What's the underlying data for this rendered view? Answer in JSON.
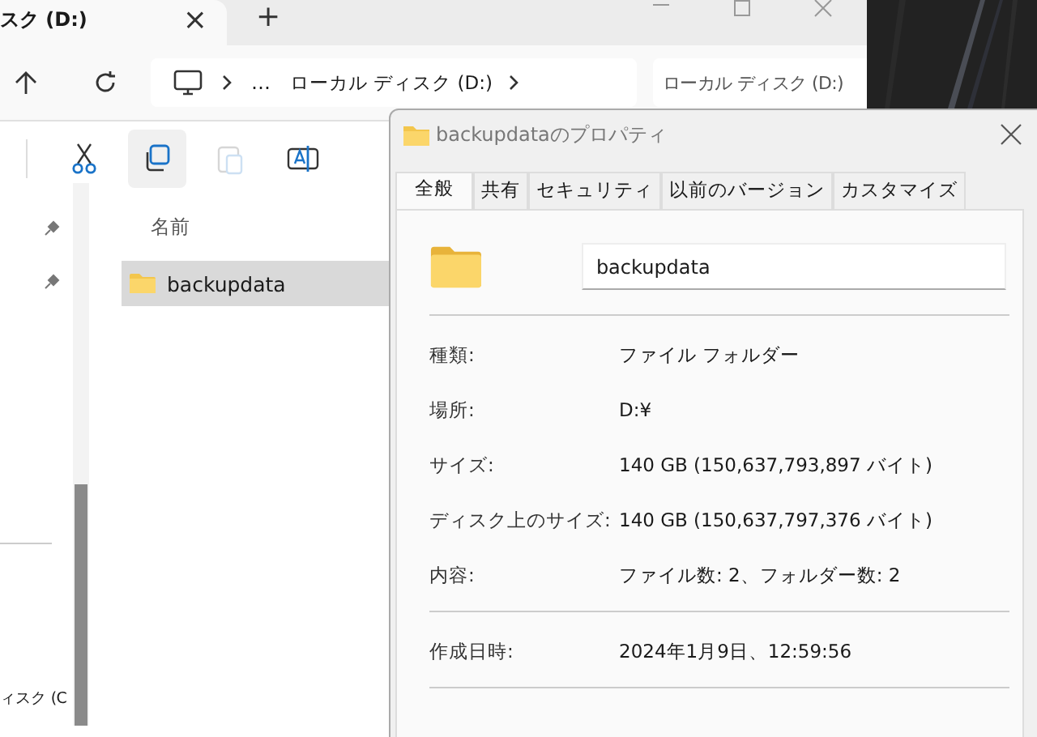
{
  "explorer": {
    "tab": {
      "title": "スク (D:)",
      "close": "×"
    },
    "new_tab": "+",
    "breadcrumb": {
      "more": "…",
      "location": "ローカル ディスク (D:)"
    },
    "search": {
      "placeholder": "ローカル ディスク (D:)"
    },
    "toolbar": [
      {
        "kind": "cut",
        "selected": false,
        "disabled": false
      },
      {
        "kind": "copy",
        "selected": true,
        "disabled": false
      },
      {
        "kind": "paste",
        "selected": false,
        "disabled": true
      },
      {
        "kind": "rename",
        "selected": false,
        "disabled": false
      }
    ],
    "sidebar": {
      "drive_label": "ィスク (C"
    },
    "column": "名前",
    "files": [
      {
        "name": "backupdata",
        "selected": true
      }
    ]
  },
  "dialog": {
    "title": "backupdataのプロパティ",
    "tabs": [
      {
        "label": "全般",
        "selected": true
      },
      {
        "label": "共有",
        "selected": false
      },
      {
        "label": "セキュリティ",
        "selected": false
      },
      {
        "label": "以前のバージョン",
        "selected": false
      },
      {
        "label": "カスタマイズ",
        "selected": false
      }
    ],
    "name": "backupdata",
    "sections": [
      [
        {
          "label": "種類:",
          "value": "ファイル フォルダー"
        },
        {
          "label": "場所:",
          "value": "D:¥"
        },
        {
          "label": "サイズ:",
          "value": "140 GB (150,637,793,897 バイト)"
        },
        {
          "label": "ディスク上のサイズ:",
          "value": "140 GB (150,637,797,376 バイト)"
        },
        {
          "label": "内容:",
          "value": "ファイル数: 2、フォルダー数: 2"
        }
      ],
      [
        {
          "label": "作成日時:",
          "value": "2024年1月9日、12:59:56"
        }
      ]
    ]
  }
}
